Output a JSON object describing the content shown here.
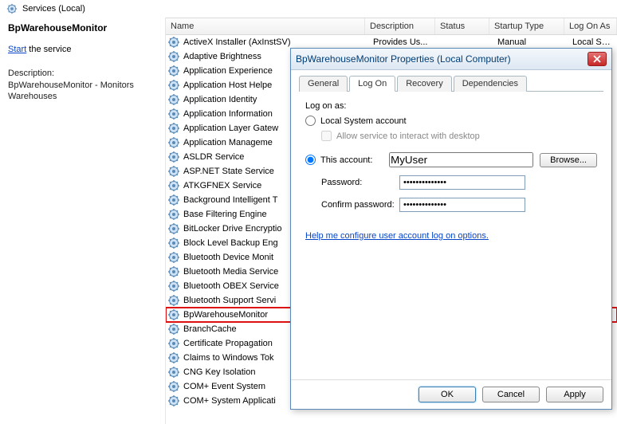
{
  "header": {
    "title": "Services (Local)"
  },
  "left": {
    "service_name": "BpWarehouseMonitor",
    "start_link": "Start",
    "start_suffix": " the service",
    "desc_label": "Description:",
    "desc_text": "BpWarehouseMonitor - Monitors Warehouses"
  },
  "columns": {
    "name": "Name",
    "desc": "Description",
    "status": "Status",
    "startup": "Startup Type",
    "logon": "Log On As"
  },
  "services": [
    {
      "name": "ActiveX Installer (AxInstSV)",
      "desc": "Provides Us...",
      "status": "",
      "startup": "Manual",
      "logon": "Local Syste..."
    },
    {
      "name": "Adaptive Brightness"
    },
    {
      "name": "Application Experience"
    },
    {
      "name": "Application Host Helpe"
    },
    {
      "name": "Application Identity"
    },
    {
      "name": "Application Information"
    },
    {
      "name": "Application Layer Gatew"
    },
    {
      "name": "Application Manageme"
    },
    {
      "name": "ASLDR Service"
    },
    {
      "name": "ASP.NET State Service"
    },
    {
      "name": "ATKGFNEX Service"
    },
    {
      "name": "Background Intelligent T"
    },
    {
      "name": "Base Filtering Engine"
    },
    {
      "name": "BitLocker Drive Encryptio"
    },
    {
      "name": "Block Level Backup Eng"
    },
    {
      "name": "Bluetooth Device Monit"
    },
    {
      "name": "Bluetooth Media Service"
    },
    {
      "name": "Bluetooth OBEX Service"
    },
    {
      "name": "Bluetooth Support Servi"
    },
    {
      "name": "BpWarehouseMonitor",
      "highlight": true
    },
    {
      "name": "BranchCache"
    },
    {
      "name": "Certificate Propagation"
    },
    {
      "name": "Claims to Windows Tok"
    },
    {
      "name": "CNG Key Isolation"
    },
    {
      "name": "COM+ Event System"
    },
    {
      "name": "COM+ System Applicati"
    }
  ],
  "dialog": {
    "title": "BpWarehouseMonitor Properties (Local Computer)",
    "tabs": {
      "general": "General",
      "logon": "Log On",
      "recovery": "Recovery",
      "dependencies": "Dependencies"
    },
    "logon_as": "Log on as:",
    "local_system": "Local System account",
    "allow_interact": "Allow service to interact with desktop",
    "this_account": "This account:",
    "account_value": "MyUser",
    "browse": "Browse...",
    "password_label": "Password:",
    "password_value": "••••••••••••••",
    "confirm_label": "Confirm password:",
    "confirm_value": "••••••••••••••",
    "help": "Help me configure user account log on options.",
    "ok": "OK",
    "cancel": "Cancel",
    "apply": "Apply"
  }
}
